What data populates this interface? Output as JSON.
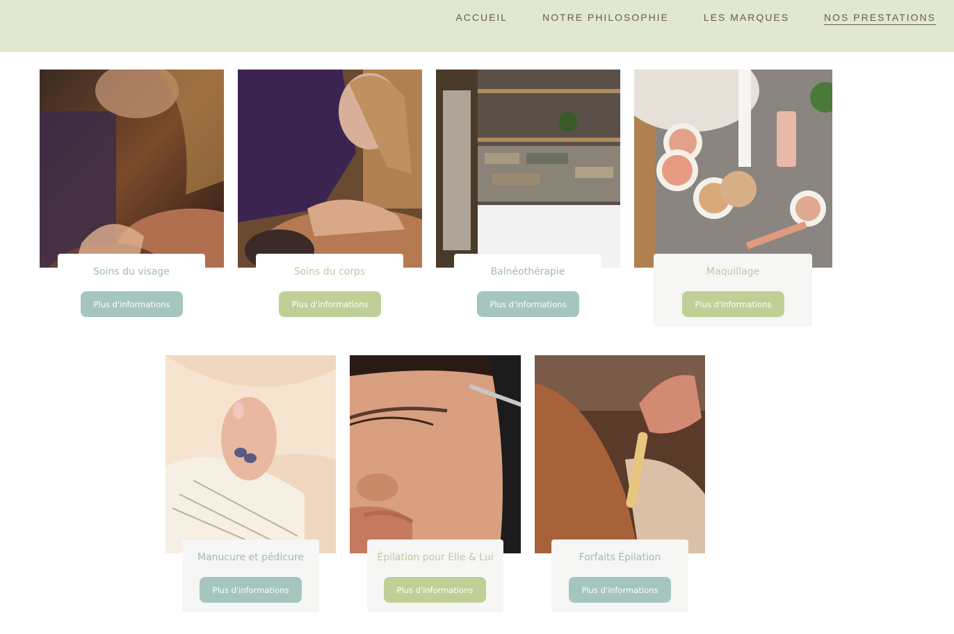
{
  "nav": {
    "items": [
      {
        "label": "ACCUEIL"
      },
      {
        "label": "NOTRE PHILOSOPHIE"
      },
      {
        "label": "LES MARQUES"
      },
      {
        "label": "NOS PRESTATIONS"
      }
    ]
  },
  "services": [
    {
      "title": "Soins du visage",
      "button": "Plus d'informations"
    },
    {
      "title": "Soins du corps",
      "button": "Plus d'informations"
    },
    {
      "title": "Balnéothérapie",
      "button": "Plus d'informations"
    },
    {
      "title": "Maquillage",
      "button": "Plus d'informations"
    },
    {
      "title": "Manucure et pédicure",
      "button": "Plus d'informations"
    },
    {
      "title": "Épilation pour Elle & Lui",
      "button": "Plus d'informations"
    },
    {
      "title": "Forfaits Épilation",
      "button": "Plus d'informations"
    }
  ],
  "colors": {
    "header_bg": "#e1e8d1",
    "nav_text": "#6b5a44",
    "button_teal": "#a4c6bf",
    "button_green": "#bfd097",
    "title_green": "#b9cc9d"
  }
}
